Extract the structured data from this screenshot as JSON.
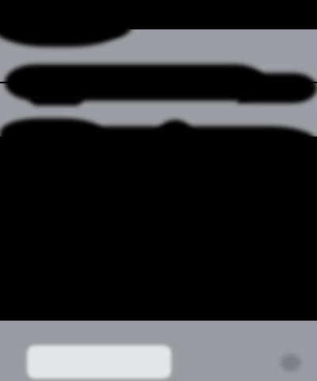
{
  "screen": {
    "background": "#000000",
    "panel_color": "#9c9ea3",
    "bottom_bar_color": "#9a9ca1"
  },
  "bottom_bar": {
    "primary_button": {
      "label": "",
      "color": "#e4e5e8"
    },
    "corner_icon": {
      "icon": "circle-icon",
      "color": "#7e8085"
    }
  }
}
